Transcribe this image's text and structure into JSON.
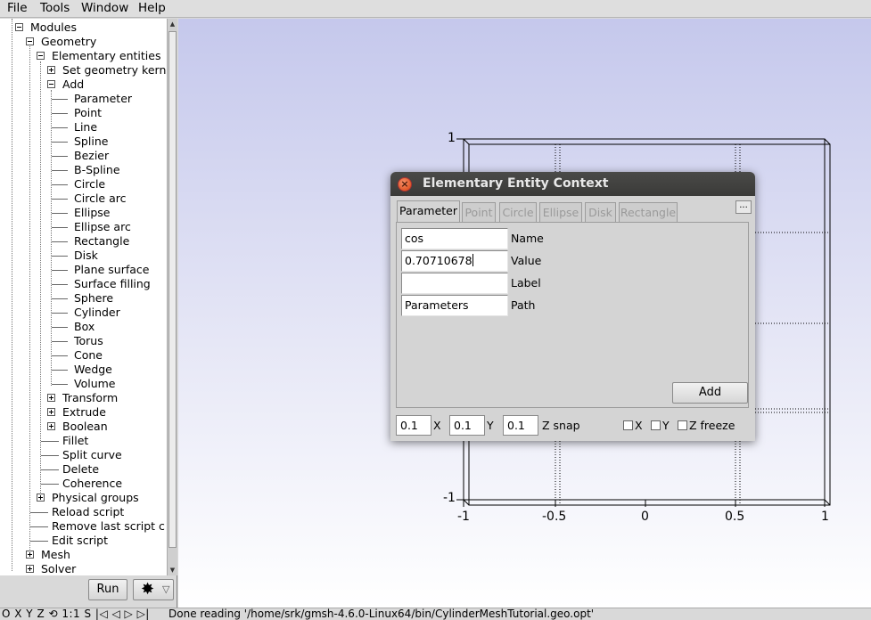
{
  "menu": {
    "file": "File",
    "tools": "Tools",
    "window": "Window",
    "help": "Help"
  },
  "tree": {
    "modules": "Modules",
    "geometry": "Geometry",
    "elementary_entities": "Elementary entities",
    "set_geometry_kernel": "Set geometry kern",
    "add": "Add",
    "add_items": [
      "Parameter",
      "Point",
      "Line",
      "Spline",
      "Bezier",
      "B-Spline",
      "Circle",
      "Circle arc",
      "Ellipse",
      "Ellipse arc",
      "Rectangle",
      "Disk",
      "Plane surface",
      "Surface filling",
      "Sphere",
      "Cylinder",
      "Box",
      "Torus",
      "Cone",
      "Wedge",
      "Volume"
    ],
    "transform": "Transform",
    "extrude": "Extrude",
    "boolean": "Boolean",
    "fillet": "Fillet",
    "split_curve": "Split curve",
    "delete": "Delete",
    "coherence": "Coherence",
    "physical_groups": "Physical groups",
    "reload_script": "Reload script",
    "remove_last": "Remove last script c",
    "edit_script": "Edit script",
    "mesh": "Mesh",
    "solver": "Solver"
  },
  "buttons": {
    "run": "Run",
    "settings_arrow": "▽"
  },
  "status": {
    "left": "O X Y Z ⟲ 1:1 S |◁ ◁ ▷ ▷|",
    "message": "Done reading '/home/srk/gmsh-4.6.0-Linux64/bin/CylinderMeshTutorial.geo.opt'"
  },
  "dialog": {
    "title": "Elementary Entity Context",
    "tabs": [
      "Parameter",
      "Point",
      "Circle",
      "Ellipse",
      "Disk",
      "Rectangle"
    ],
    "more": "...",
    "fields": {
      "name_value": "cos",
      "name_label": "Name",
      "value_value": "0.70710678",
      "value_label": "Value",
      "label_value": "",
      "label_label": "Label",
      "path_value": "Parameters",
      "path_label": "Path"
    },
    "add_button": "Add",
    "snap": {
      "x": "0.1",
      "x_label": "X",
      "y": "0.1",
      "y_label": "Y",
      "z": "0.1",
      "z_label": "Z snap",
      "chk_x": "X",
      "chk_y": "Y",
      "chk_z": "Z freeze"
    }
  },
  "axes": {
    "y_top": "1",
    "y_bottom": "-1",
    "x_ticks": [
      "-1",
      "-0.5",
      "0",
      "0.5",
      "1"
    ]
  },
  "colors": {
    "bg_top": "#c5c8ec",
    "title_bar": "#3f3f3d",
    "close_button": "#e25a2a"
  }
}
